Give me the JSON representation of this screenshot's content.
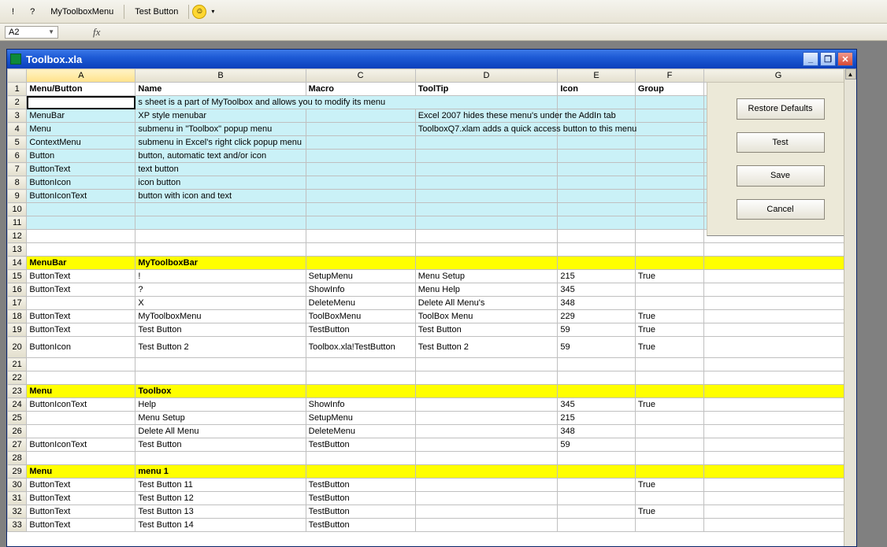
{
  "toolbar": {
    "btn1": "!",
    "btn2": "?",
    "mytoolbox": "MyToolboxMenu",
    "testbutton": "Test Button"
  },
  "namebox": "A2",
  "window_title": "Toolbox.xla",
  "winbtns": {
    "min": "_",
    "max": "❐",
    "close": "✕"
  },
  "columns": [
    "",
    "A",
    "B",
    "C",
    "D",
    "E",
    "F",
    "G"
  ],
  "headers": {
    "A": "Menu/Button",
    "B": "Name",
    "C": "Macro",
    "D": "ToolTip",
    "E": "Icon",
    "F": "Group"
  },
  "note_row": {
    "B": "s sheet is a part of MyToolbox and allows you to modify its menu"
  },
  "desc": [
    {
      "rn": 3,
      "A": "MenuBar",
      "B": "XP style menubar",
      "D": "Excel 2007 hides these menu's under the AddIn tab"
    },
    {
      "rn": 4,
      "A": "Menu",
      "B": "submenu in \"Toolbox\" popup menu",
      "D": "ToolboxQ7.xlam adds a quick access button to this menu"
    },
    {
      "rn": 5,
      "A": "ContextMenu",
      "B": "submenu in Excel's right click popup menu"
    },
    {
      "rn": 6,
      "A": "Button",
      "B": "button, automatic text and/or icon"
    },
    {
      "rn": 7,
      "A": "ButtonText",
      "B": "text button"
    },
    {
      "rn": 8,
      "A": "ButtonIcon",
      "B": "icon button"
    },
    {
      "rn": 9,
      "A": "ButtonIconText",
      "B": "button with icon and text"
    }
  ],
  "rows": [
    {
      "rn": 10
    },
    {
      "rn": 11
    },
    {
      "rn": 12,
      "plain": true
    },
    {
      "rn": 13,
      "plain": true
    },
    {
      "rn": 14,
      "yellow": true,
      "A": "MenuBar",
      "B": "MyToolboxBar"
    },
    {
      "rn": 15,
      "A": "ButtonText",
      "B": "!",
      "C": "SetupMenu",
      "D": "Menu Setup",
      "E": "215",
      "F": "True"
    },
    {
      "rn": 16,
      "A": "ButtonText",
      "B": "?",
      "C": "ShowInfo",
      "D": "Menu Help",
      "E": "345"
    },
    {
      "rn": 17,
      "B": "X",
      "C": "DeleteMenu",
      "D": "Delete All Menu's",
      "E": "348"
    },
    {
      "rn": 18,
      "A": "ButtonText",
      "B": "MyToolboxMenu",
      "C": "ToolBoxMenu",
      "D": "ToolBox Menu",
      "E": "229",
      "F": "True"
    },
    {
      "rn": 19,
      "A": "ButtonText",
      "B": "Test Button",
      "C": "TestButton",
      "D": "Test Button",
      "E": "59",
      "F": "True"
    },
    {
      "rn": 20,
      "A": "ButtonIcon",
      "B": "Test Button 2",
      "C": "Toolbox.xla!TestButton",
      "D": "Test Button 2",
      "E": "59",
      "F": "True",
      "tall": true
    },
    {
      "rn": 21
    },
    {
      "rn": 22
    },
    {
      "rn": 23,
      "yellow": true,
      "A": "Menu",
      "B": "Toolbox"
    },
    {
      "rn": 24,
      "A": "ButtonIconText",
      "B": "Help",
      "C": "ShowInfo",
      "E": "345",
      "F": "True"
    },
    {
      "rn": 25,
      "B": "Menu Setup",
      "C": "SetupMenu",
      "E": "215"
    },
    {
      "rn": 26,
      "B": "Delete All Menu",
      "C": "DeleteMenu",
      "E": "348"
    },
    {
      "rn": 27,
      "A": "ButtonIconText",
      "B": "Test Button",
      "C": "TestButton",
      "E": "59"
    },
    {
      "rn": 28
    },
    {
      "rn": 29,
      "yellow": true,
      "A": "Menu",
      "B": "menu 1"
    },
    {
      "rn": 30,
      "A": "ButtonText",
      "B": "Test Button 11",
      "C": "TestButton",
      "F": "True"
    },
    {
      "rn": 31,
      "A": "ButtonText",
      "B": "Test Button 12",
      "C": "TestButton"
    },
    {
      "rn": 32,
      "A": "ButtonText",
      "B": "Test Button 13",
      "C": "TestButton",
      "F": "True"
    },
    {
      "rn": 33,
      "A": "ButtonText",
      "B": "Test Button 14",
      "C": "TestButton"
    }
  ],
  "side": {
    "restore": "Restore Defaults",
    "test": "Test",
    "save": "Save",
    "cancel": "Cancel"
  }
}
